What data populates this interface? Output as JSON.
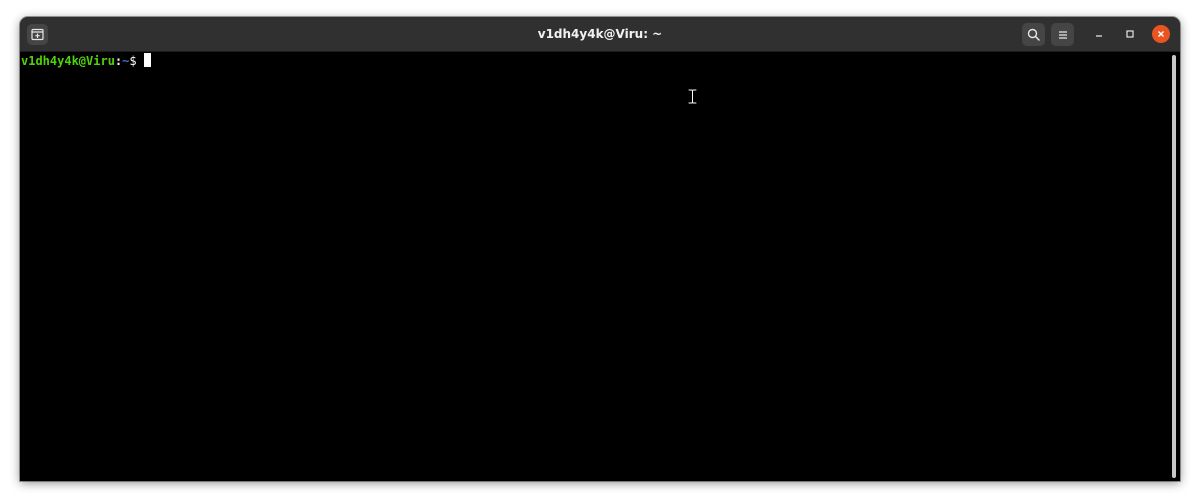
{
  "window": {
    "title": "v1dh4y4k@Viru: ~"
  },
  "titlebar": {
    "new_tab_icon": "new-tab-icon",
    "search_icon": "search-icon",
    "menu_icon": "hamburger-menu-icon",
    "minimize_icon": "minimize-icon",
    "maximize_icon": "maximize-icon",
    "close_icon": "close-icon"
  },
  "terminal": {
    "prompt": {
      "user_host": "v1dh4y4k@Viru",
      "colon": ":",
      "path": "~",
      "symbol": "$ "
    },
    "background": "#000000"
  },
  "colors": {
    "titlebar": "#303030",
    "prompt_user_host": "#4fd20a",
    "prompt_path": "#3b6fd6",
    "close_button": "#e95420"
  }
}
